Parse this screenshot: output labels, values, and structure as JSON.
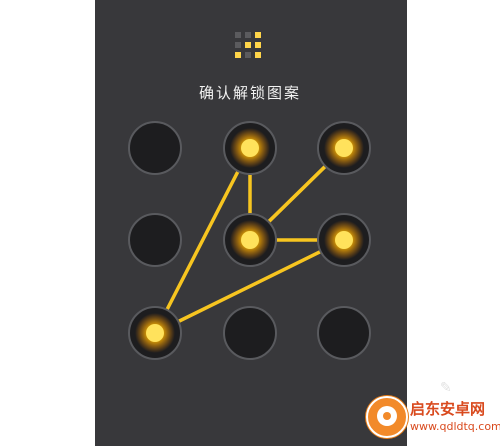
{
  "screen": {
    "title": "确认解锁图案"
  },
  "preview": {
    "grid_state": [
      false,
      false,
      true,
      false,
      true,
      true,
      true,
      false,
      true
    ]
  },
  "pattern": {
    "nodes": [
      {
        "id": 1,
        "label": "node-1",
        "active": false
      },
      {
        "id": 2,
        "label": "node-2",
        "active": true
      },
      {
        "id": 3,
        "label": "node-3",
        "active": true
      },
      {
        "id": 4,
        "label": "node-4",
        "active": false
      },
      {
        "id": 5,
        "label": "node-5",
        "active": true
      },
      {
        "id": 6,
        "label": "node-6",
        "active": true
      },
      {
        "id": 7,
        "label": "node-7",
        "active": true
      },
      {
        "id": 8,
        "label": "node-8",
        "active": false
      },
      {
        "id": 9,
        "label": "node-9",
        "active": false
      }
    ],
    "sequence": [
      7,
      2,
      5,
      3,
      5,
      6,
      7
    ]
  },
  "colors": {
    "background": "#38383b",
    "accent": "#ffd000",
    "inactive_node": "#1d1d1f"
  },
  "watermark": {
    "name": "启东安卓网",
    "url": "www.qdldtq.com"
  }
}
